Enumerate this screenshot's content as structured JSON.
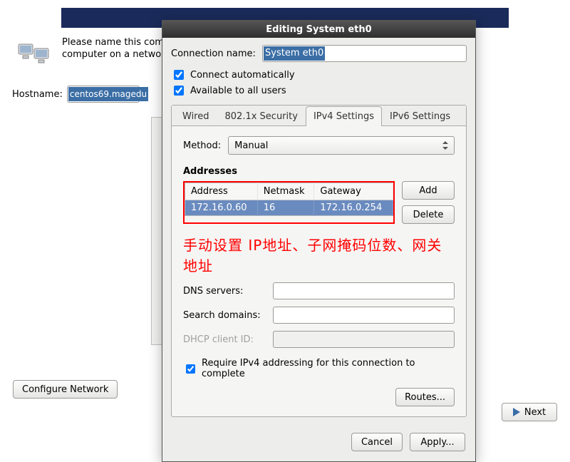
{
  "background": {
    "help_text": "Please name this computer. The hostname identifies the computer on a network.",
    "hostname_label": "Hostname:",
    "hostname_value": "centos69.magedu",
    "configure_network": "Configure Network",
    "next": "Next"
  },
  "dialog": {
    "title": "Editing System eth0",
    "connection_name_label": "Connection name:",
    "connection_name_value": "System eth0",
    "connect_auto": "Connect automatically",
    "available_all": "Available to all users",
    "tabs": {
      "wired": "Wired",
      "security": "802.1x Security",
      "ipv4": "IPv4 Settings",
      "ipv6": "IPv6 Settings"
    },
    "method_label": "Method:",
    "method_value": "Manual",
    "addresses_label": "Addresses",
    "headers": {
      "address": "Address",
      "netmask": "Netmask",
      "gateway": "Gateway"
    },
    "row": {
      "address": "172.16.0.60",
      "netmask": "16",
      "gateway": "172.16.0.254"
    },
    "add": "Add",
    "delete": "Delete",
    "annotation": "手动设置 IP地址、子网掩码位数、网关地址",
    "dns_label": "DNS servers:",
    "search_label": "Search domains:",
    "dhcp_label": "DHCP client ID:",
    "require": "Require IPv4 addressing for this connection to complete",
    "routes": "Routes...",
    "cancel": "Cancel",
    "apply": "Apply..."
  },
  "chart_data": {
    "type": "table",
    "title": "Addresses",
    "columns": [
      "Address",
      "Netmask",
      "Gateway"
    ],
    "rows": [
      [
        "172.16.0.60",
        "16",
        "172.16.0.254"
      ]
    ]
  }
}
